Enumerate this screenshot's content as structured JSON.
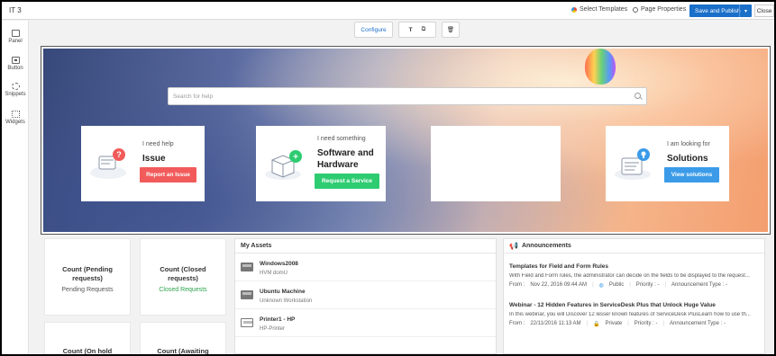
{
  "app": {
    "title": "IT 3"
  },
  "topbar": {
    "select_templates": "Select Templates",
    "page_properties": "Page Properties",
    "save_publish": "Save and Publish",
    "close": "Close"
  },
  "rail": {
    "panel": "Panel",
    "button": "Button",
    "snippets": "Snippets",
    "widgets": "Widgets"
  },
  "tools": {
    "configure": "Configure",
    "text": "T"
  },
  "banner": {
    "search_placeholder": "Search for help",
    "cards": [
      {
        "small": "I need help",
        "big": "Issue",
        "button": "Report an Issue",
        "color": "#f25b5b"
      },
      {
        "small": "I need something",
        "big_line1": "Software and",
        "big_line2": "Hardware",
        "button": "Request a Service",
        "color": "#2ecc71"
      },
      {
        "small": "I am looking for",
        "big": "Solutions",
        "button": "View solutions",
        "color": "#3b9be8"
      }
    ]
  },
  "counts": [
    {
      "title_line1": "Count (Pending",
      "title_line2": "requests)",
      "value": "Pending Requests",
      "value_color": "#555555"
    },
    {
      "title_line1": "Count (Closed",
      "title_line2": "requests)",
      "value": "Closed Requests",
      "value_color": "#2ea44f"
    },
    {
      "title_line1": "Count (On hold"
    },
    {
      "title_line1": "Count (Awaiting"
    }
  ],
  "assets": {
    "title": "My Assets",
    "items": [
      {
        "name": "Windows2008",
        "sub": "HVM domU"
      },
      {
        "name": "Ubuntu Machine",
        "sub": "Unknown Workstation"
      },
      {
        "name": "Printer1 - HP",
        "sub": "HP-Printer"
      }
    ]
  },
  "announcements": {
    "title": "Announcements",
    "items": [
      {
        "title": "Templates for Field and Form Rules",
        "desc": "With Field and Form rules, the administrator can decide on the fields to be displayed to the request...",
        "from_label": "From :",
        "from": "Nov 22, 2016 09:44 AM",
        "visibility": "Public",
        "priority": "Priority : -",
        "type": "Announcement Type : -"
      },
      {
        "title": "Webinar - 12 Hidden Features in ServiceDesk Plus that Unlock Huge Value",
        "desc": "In this webinar, you will Discover 12 lesser known features of ServiceDesk PlusLearn how to use th...",
        "from_label": "From :",
        "from": "22/11/2016 11:13 AM",
        "visibility": "Private",
        "priority": "Priority : -",
        "type": "Announcement Type : -"
      }
    ]
  },
  "colors": {
    "primary": "#1a6fc9",
    "accent_red": "#f25b5b",
    "accent_green": "#2ecc71",
    "accent_blue": "#3b9be8"
  }
}
